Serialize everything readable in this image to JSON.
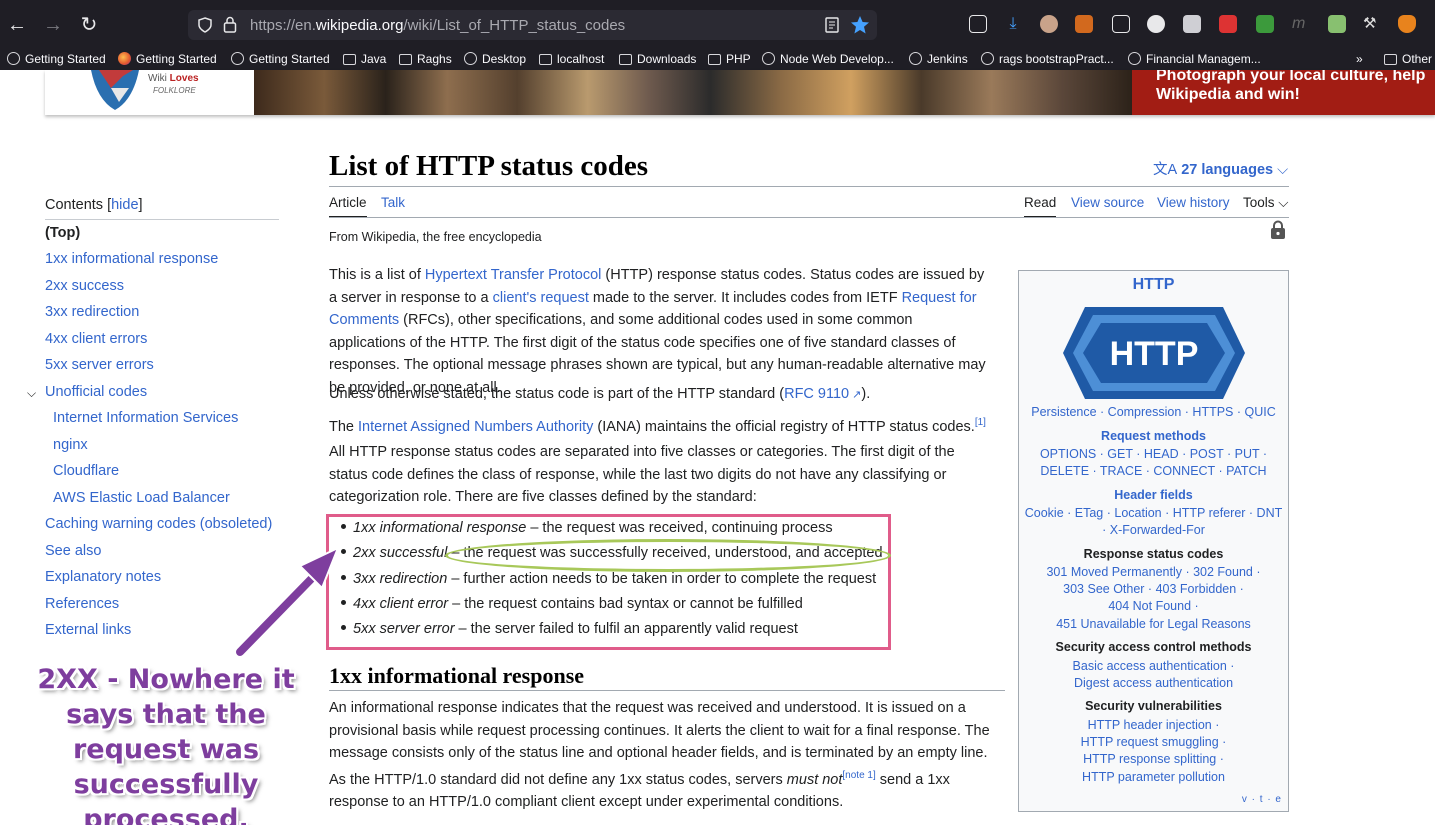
{
  "browser": {
    "url_prefix": "https://en.",
    "url_domain": "wikipedia.org",
    "url_path": "/wiki/List_of_HTTP_status_codes",
    "bookmarks": [
      {
        "label": "Getting Started",
        "icon": "globe-icon"
      },
      {
        "label": "Getting Started",
        "icon": "firefox-icon"
      },
      {
        "label": "Getting Started",
        "icon": "globe-icon"
      },
      {
        "label": "Java",
        "icon": "folder-icon"
      },
      {
        "label": "Raghs",
        "icon": "folder-icon"
      },
      {
        "label": "Desktop",
        "icon": "globe-icon"
      },
      {
        "label": "localhost",
        "icon": "folder-icon"
      },
      {
        "label": "Downloads",
        "icon": "folder-icon"
      },
      {
        "label": "PHP",
        "icon": "folder-icon"
      },
      {
        "label": "Node Web Develop...",
        "icon": "globe-icon"
      },
      {
        "label": "Jenkins",
        "icon": "globe-icon"
      },
      {
        "label": "rags bootstrapPract...",
        "icon": "globe-icon"
      },
      {
        "label": "Financial Managem...",
        "icon": "globe-icon"
      },
      {
        "label": "Other",
        "icon": "folder-icon"
      }
    ]
  },
  "banner": {
    "logo_line1": "Wiki",
    "logo_line1b": "Loves",
    "logo_line2": "FOLKLORE",
    "cta_line1": "Photograph your local culture, help",
    "cta_line2": "Wikipedia and win!"
  },
  "toc": {
    "title": "Contents",
    "hide_label": "hide",
    "items": [
      {
        "label": "(Top)"
      },
      {
        "label": "1xx informational response"
      },
      {
        "label": "2xx success"
      },
      {
        "label": "3xx redirection"
      },
      {
        "label": "4xx client errors"
      },
      {
        "label": "5xx server errors"
      },
      {
        "label": "Unofficial codes"
      },
      {
        "label": "Internet Information Services"
      },
      {
        "label": "nginx"
      },
      {
        "label": "Cloudflare"
      },
      {
        "label": "AWS Elastic Load Balancer"
      },
      {
        "label": "Caching warning codes (obsoleted)"
      },
      {
        "label": "See also"
      },
      {
        "label": "Explanatory notes"
      },
      {
        "label": "References"
      },
      {
        "label": "External links"
      }
    ]
  },
  "article": {
    "title": "List of HTTP status codes",
    "languages": "27 languages",
    "tabs": {
      "article": "Article",
      "talk": "Talk",
      "read": "Read",
      "view_source": "View source",
      "view_history": "View history",
      "tools": "Tools"
    },
    "tagline": "From Wikipedia, the free encyclopedia",
    "p1": {
      "a": "This is a list of ",
      "link1": "Hypertext Transfer Protocol",
      "b": " (HTTP) response status codes. Status codes are issued by a server in response to a ",
      "link2": "client's request",
      "c": " made to the server. It includes codes from IETF ",
      "link3": "Request for Comments",
      "d": " (RFCs), other specifications, and some additional codes used in some common applications of the HTTP. The first digit of the status code specifies one of five standard classes of responses. The optional message phrases shown are typical, but any human-readable alternative may be provided, or none at all."
    },
    "p2": {
      "a": "Unless otherwise stated, the status code is part of the HTTP standard (",
      "link": "RFC 9110",
      "b": ")."
    },
    "p3": {
      "a": "The ",
      "link": "Internet Assigned Numbers Authority",
      "b": " (IANA) maintains the official registry of HTTP status codes.",
      "ref": "[1]"
    },
    "p4": "All HTTP response status codes are separated into five classes or categories. The first digit of the status code defines the class of response, while the last two digits do not have any classifying or categorization role. There are five classes defined by the standard:",
    "classes": [
      {
        "name": "1xx informational response",
        "desc": " – the request was received, continuing process"
      },
      {
        "name": "2xx successful",
        "desc": " – the request was successfully received, understood, and accepted"
      },
      {
        "name": "3xx redirection",
        "desc": " – further action needs to be taken in order to complete the request"
      },
      {
        "name": "4xx client error",
        "desc": " – the request contains bad syntax or cannot be fulfilled"
      },
      {
        "name": "5xx server error",
        "desc": " – the server failed to fulfil an apparently valid request"
      }
    ],
    "section1_title": "1xx informational response",
    "section1_p": {
      "a": "An informational response indicates that the request was received and understood. It is issued on a provisional basis while request processing continues. It alerts the client to wait for a final response. The message consists only of the status line and optional header fields, and is terminated by an empty line. As the HTTP/1.0 standard did not define any 1xx status codes, servers ",
      "em": "must not",
      "note": "[note 1]",
      "b": " send a 1xx response to an HTTP/1.0 compliant client except under experimental conditions."
    }
  },
  "infobox": {
    "title": "HTTP",
    "logo_text": "HTTP",
    "topics": "Persistence · Compression · HTTPS · QUIC",
    "request_methods_head": "Request methods",
    "request_methods_1": "OPTIONS · GET · HEAD · POST · PUT ·",
    "request_methods_2": "DELETE · TRACE · CONNECT · PATCH",
    "header_fields_head": "Header fields",
    "header_fields_1": "Cookie · ETag · Location · HTTP referer · DNT",
    "header_fields_2": "· X-Forwarded-For",
    "status_codes_head": "Response status codes",
    "status_codes_1": "301 Moved Permanently · 302 Found ·",
    "status_codes_2": "303 See Other · 403 Forbidden ·",
    "status_codes_3": "404 Not Found ·",
    "status_codes_4": "451 Unavailable for Legal Reasons",
    "security_head": "Security access control methods",
    "security_1": "Basic access authentication ·",
    "security_2": "Digest access authentication",
    "vuln_head": "Security vulnerabilities",
    "vuln_1": "HTTP header injection ·",
    "vuln_2": "HTTP request smuggling ·",
    "vuln_3": "HTTP response splitting ·",
    "vuln_4": "HTTP parameter pollution",
    "vte": "v · t · e"
  },
  "annotation": {
    "text": "2XX - Nowhere it says that the request was successfully processed.",
    "color": "#7e3e9e"
  },
  "colors": {
    "link": "#3366cc",
    "highlight_box": "#e05c8a",
    "oval": "#a8c85a",
    "banner_red": "#a21d14"
  }
}
